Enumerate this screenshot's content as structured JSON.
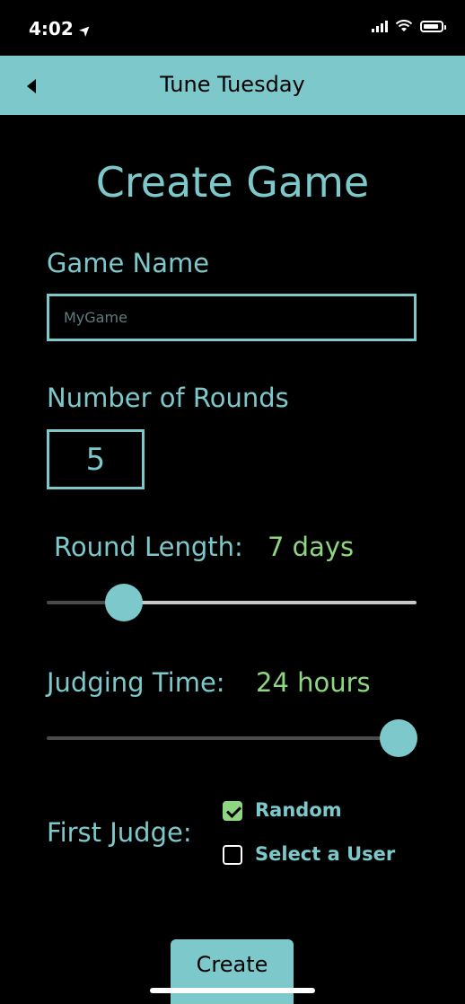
{
  "status_bar": {
    "time": "4:02"
  },
  "nav": {
    "title": "Tune Tuesday"
  },
  "page": {
    "heading": "Create Game"
  },
  "game_name": {
    "label": "Game Name",
    "placeholder": "MyGame"
  },
  "rounds": {
    "label": "Number of Rounds",
    "value": "5"
  },
  "round_length": {
    "label": "Round Length:",
    "value": "7 days",
    "slider_fraction": 0.21
  },
  "judging_time": {
    "label": "Judging Time:",
    "value": "24 hours",
    "slider_fraction": 1.0
  },
  "first_judge": {
    "label": "First Judge:",
    "options": [
      {
        "label": "Random",
        "checked": true
      },
      {
        "label": "Select a User",
        "checked": false
      }
    ]
  },
  "actions": {
    "create_label": "Create"
  },
  "colors": {
    "accent": "#7cc8cb",
    "value_green": "#8fd680",
    "background": "#000000"
  }
}
